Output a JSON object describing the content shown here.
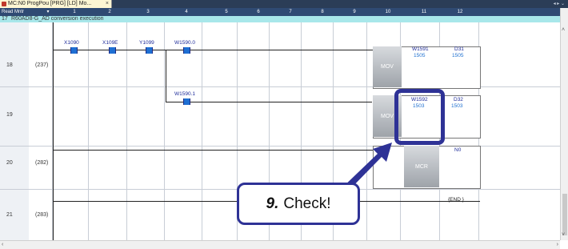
{
  "tab": {
    "title": "MC:N0 ProgPou [PRG] [LD] Mo...",
    "close": "×",
    "window_buttons": "◂ ▸ ⌄"
  },
  "header": {
    "mode": "Read Mntr",
    "columns": [
      "1",
      "2",
      "3",
      "4",
      "5",
      "6",
      "7",
      "8",
      "9",
      "10",
      "11",
      "12"
    ]
  },
  "row17": {
    "num": "17",
    "comment": "R60AD8-G_AD conversion execution"
  },
  "rows": [
    {
      "num": "18",
      "step": "(237)"
    },
    {
      "num": "19",
      "step": ""
    },
    {
      "num": "20",
      "step": "(282)"
    },
    {
      "num": "21",
      "step": "(283)"
    }
  ],
  "contacts": {
    "c1": "X1090",
    "c2": "X109E",
    "c3": "Y1099",
    "c4": "W1590.0",
    "c5": "W1590.1"
  },
  "mov1": {
    "op": "MOV",
    "src": "W1591",
    "src_val": "1505",
    "dst": "D31",
    "dst_val": "1505"
  },
  "mov2": {
    "op": "MOV",
    "src": "W1592",
    "src_val": "1503",
    "dst": "D32",
    "dst_val": "1503"
  },
  "mcr": {
    "op": "MCR",
    "operand": "N0"
  },
  "end": {
    "label": "{END }"
  },
  "callout": {
    "number": "9.",
    "text": "Check!"
  },
  "colors": {
    "accent": "#2e3296",
    "header": "#2f4a73",
    "comment": "#a8e7ea"
  }
}
